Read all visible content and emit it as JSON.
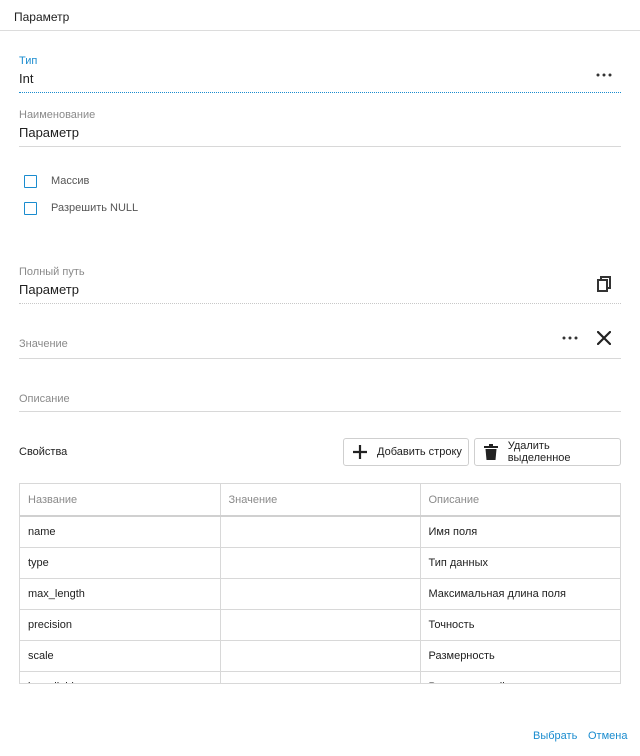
{
  "dialog": {
    "title": "Параметр"
  },
  "type_field": {
    "label": "Тип",
    "value": "Int",
    "more_icon": "more-horizontal-icon"
  },
  "name_field": {
    "label": "Наименование",
    "value": "Параметр"
  },
  "checkboxes": [
    {
      "label": "Массив",
      "checked": false
    },
    {
      "label": "Разрешить NULL",
      "checked": false
    }
  ],
  "full_path_field": {
    "label": "Полный путь",
    "value": "Параметр",
    "copy_icon": "copy-icon"
  },
  "value_field": {
    "label": "Значение",
    "more_icon": "more-horizontal-icon",
    "clear_icon": "close-icon"
  },
  "description_field": {
    "label": "Описание"
  },
  "properties": {
    "title": "Свойства",
    "add_button": "Добавить строку",
    "delete_button": "Удалить выделенное",
    "columns": [
      "Название",
      "Значение",
      "Описание"
    ],
    "rows": [
      [
        "name",
        "",
        "Имя поля"
      ],
      [
        "type",
        "",
        "Тип данных"
      ],
      [
        "max_length",
        "",
        "Максимальная длина поля"
      ],
      [
        "precision",
        "",
        "Точность"
      ],
      [
        "scale",
        "",
        "Размерность"
      ],
      [
        "is_nullable",
        "",
        "Разрешить null"
      ]
    ]
  },
  "footer": {
    "select": "Выбрать",
    "cancel": "Отмена"
  },
  "colors": {
    "accent": "#1a8ccf",
    "text": "#212121",
    "muted": "#8a8a8a",
    "border": "#d8d8d8"
  }
}
